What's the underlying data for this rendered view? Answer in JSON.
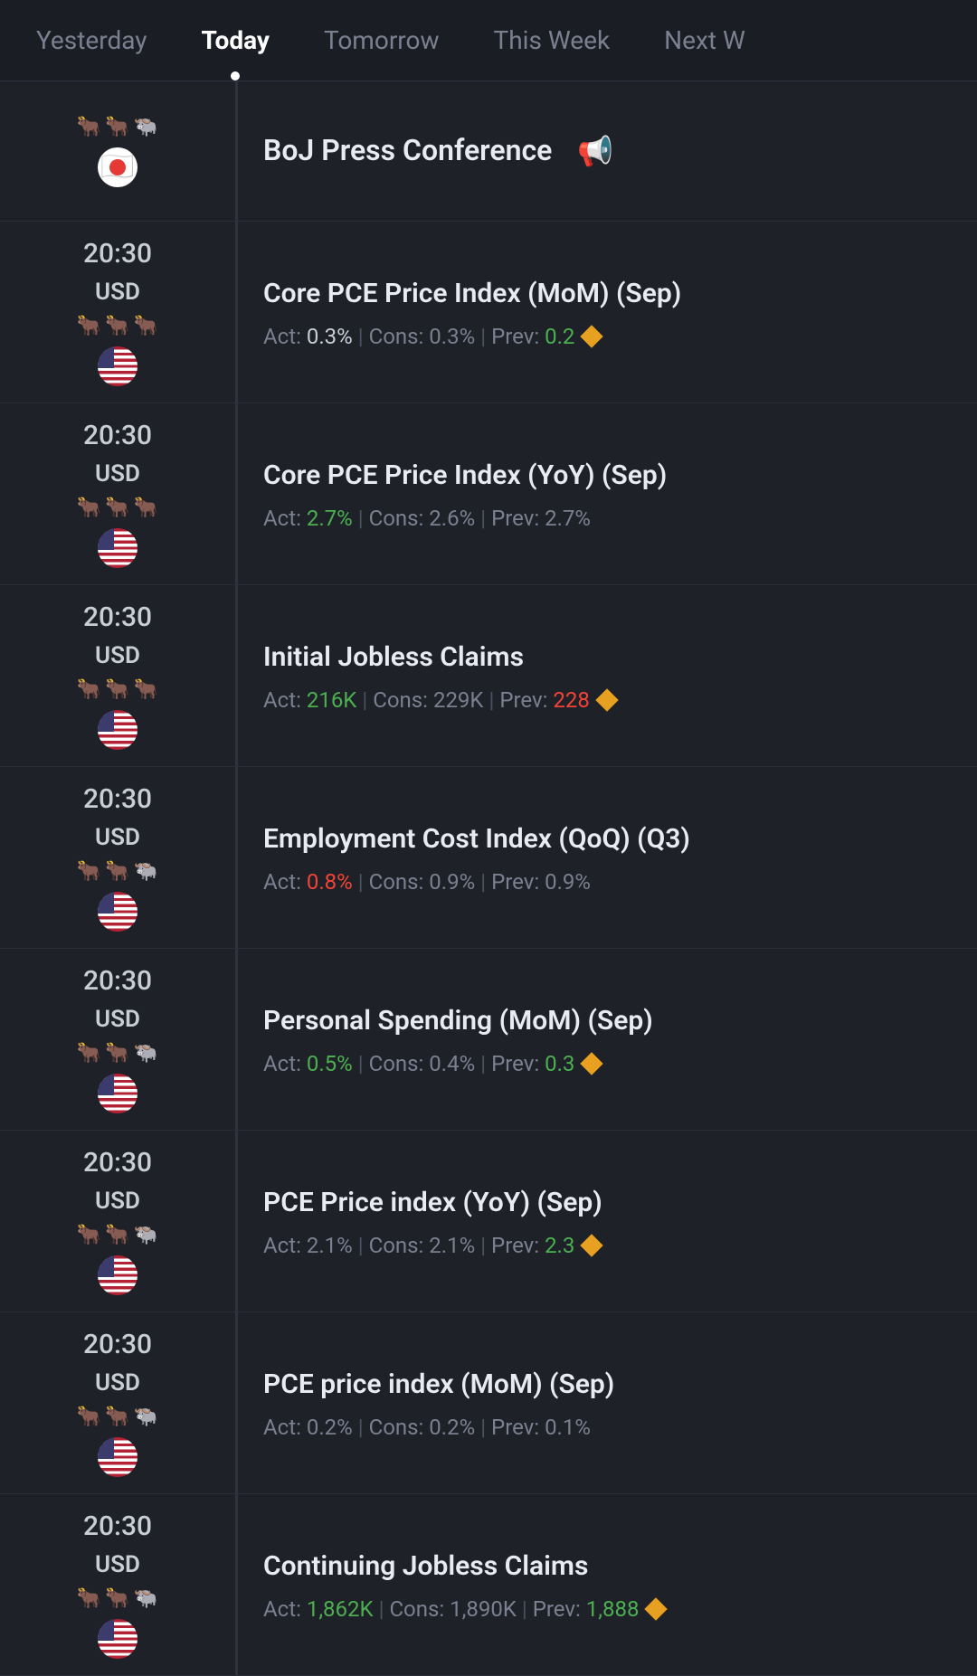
{
  "tabs": [
    {
      "id": "yesterday",
      "label": "Yesterday",
      "active": false
    },
    {
      "id": "today",
      "label": "Today",
      "active": true
    },
    {
      "id": "tomorrow",
      "label": "Tomorrow",
      "active": false
    },
    {
      "id": "this-week",
      "label": "This Week",
      "active": false
    },
    {
      "id": "next",
      "label": "Next W",
      "active": false
    }
  ],
  "events": [
    {
      "id": "boj",
      "time": "",
      "currency": "",
      "bulls": [
        "🐂",
        "🐂",
        "🐂"
      ],
      "flag": "jp",
      "name": "BoJ Press Conference",
      "hasRedCircle": true,
      "hasMegaphone": true,
      "stats": null
    },
    {
      "id": "core-pce-mom",
      "time": "20:30",
      "currency": "USD",
      "bulls": [
        "🐂",
        "🐂",
        "🐂"
      ],
      "flag": "us",
      "name": "Core PCE Price Index (MoM) (Sep)",
      "stats": {
        "act": {
          "value": "0.3%",
          "color": "neutral"
        },
        "cons": {
          "value": "0.3%",
          "color": "neutral"
        },
        "prev": {
          "value": "0.2",
          "color": "green"
        },
        "diamond": true
      }
    },
    {
      "id": "core-pce-yoy",
      "time": "20:30",
      "currency": "USD",
      "bulls": [
        "🐂",
        "🐂",
        "🐂"
      ],
      "flag": "us",
      "name": "Core PCE Price Index (YoY) (Sep)",
      "stats": {
        "act": {
          "value": "2.7%",
          "color": "green"
        },
        "cons": {
          "value": "2.6%",
          "color": "neutral"
        },
        "prev": {
          "value": "2.7%",
          "color": "neutral"
        },
        "diamond": false
      }
    },
    {
      "id": "initial-jobless",
      "time": "20:30",
      "currency": "USD",
      "bulls": [
        "🐂",
        "🐂",
        "🐂"
      ],
      "flag": "us",
      "name": "Initial Jobless Claims",
      "stats": {
        "act": {
          "value": "216K",
          "color": "green"
        },
        "cons": {
          "value": "229K",
          "color": "neutral"
        },
        "prev": {
          "value": "228",
          "color": "red"
        },
        "diamond": true
      }
    },
    {
      "id": "employment-cost",
      "time": "20:30",
      "currency": "USD",
      "bulls": [
        "🐂",
        "🐂",
        "🐃"
      ],
      "flag": "us",
      "name": "Employment Cost Index (QoQ) (Q3)",
      "stats": {
        "act": {
          "value": "0.8%",
          "color": "red"
        },
        "cons": {
          "value": "0.9%",
          "color": "neutral"
        },
        "prev": {
          "value": "0.9%",
          "color": "neutral"
        },
        "diamond": false
      }
    },
    {
      "id": "personal-spending",
      "time": "20:30",
      "currency": "USD",
      "bulls": [
        "🐂",
        "🐂",
        "🐃"
      ],
      "flag": "us",
      "name": "Personal Spending (MoM) (Sep)",
      "stats": {
        "act": {
          "value": "0.5%",
          "color": "green"
        },
        "cons": {
          "value": "0.4%",
          "color": "neutral"
        },
        "prev": {
          "value": "0.3",
          "color": "green"
        },
        "diamond": true
      }
    },
    {
      "id": "pce-price-yoy",
      "time": "20:30",
      "currency": "USD",
      "bulls": [
        "🐂",
        "🐂",
        "🐃"
      ],
      "flag": "us",
      "name": "PCE Price index (YoY) (Sep)",
      "stats": {
        "act": {
          "value": "2.1%",
          "color": "neutral"
        },
        "cons": {
          "value": "2.1%",
          "color": "neutral"
        },
        "prev": {
          "value": "2.3",
          "color": "green"
        },
        "diamond": true
      }
    },
    {
      "id": "pce-price-mom",
      "time": "20:30",
      "currency": "USD",
      "bulls": [
        "🐂",
        "🐂",
        "🐃"
      ],
      "flag": "us",
      "name": "PCE price index (MoM) (Sep)",
      "stats": {
        "act": {
          "value": "0.2%",
          "color": "neutral"
        },
        "cons": {
          "value": "0.2%",
          "color": "neutral"
        },
        "prev": {
          "value": "0.1%",
          "color": "neutral"
        },
        "diamond": false
      }
    },
    {
      "id": "continuing-jobless",
      "time": "20:30",
      "currency": "USD",
      "bulls": [
        "🐂",
        "🐂",
        "🐃"
      ],
      "flag": "us",
      "name": "Continuing Jobless Claims",
      "stats": {
        "act": {
          "value": "1,862K",
          "color": "green"
        },
        "cons": {
          "value": "1,890K",
          "color": "neutral"
        },
        "prev": {
          "value": "1,888",
          "color": "green"
        },
        "diamond": true
      }
    }
  ],
  "colors": {
    "green": "#4caf50",
    "red": "#f44336",
    "diamond": "#e8a020",
    "neutral": "#7a8090"
  }
}
